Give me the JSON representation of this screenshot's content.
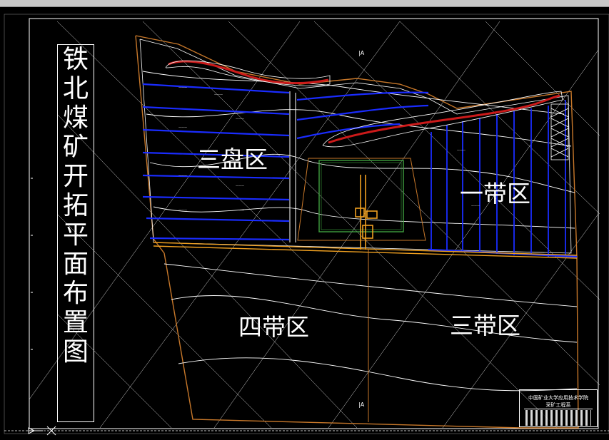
{
  "title_chars": [
    "铁",
    "北",
    "煤",
    "矿",
    "开",
    "拓",
    "平",
    "面",
    "布",
    "置",
    "图"
  ],
  "zones": {
    "zone_3pan": "三盘区",
    "zone_1dai": "一带区",
    "zone_4dai": "四带区",
    "zone_3dai": "三带区"
  },
  "section_marks": {
    "top": "A",
    "bottom": "A"
  },
  "title_block": {
    "line1": "中国矿业大学应用技术学院",
    "line2": "采矿工程系"
  },
  "colors": {
    "background": "#000000",
    "boundary": "#c8782a",
    "roadway_blue": "#1a2cff",
    "contour": "#ffffff",
    "main_haulage": "#f0a020",
    "coal_pillar_red": "#cc1a1a",
    "industrial_green": "#3fa03f"
  }
}
